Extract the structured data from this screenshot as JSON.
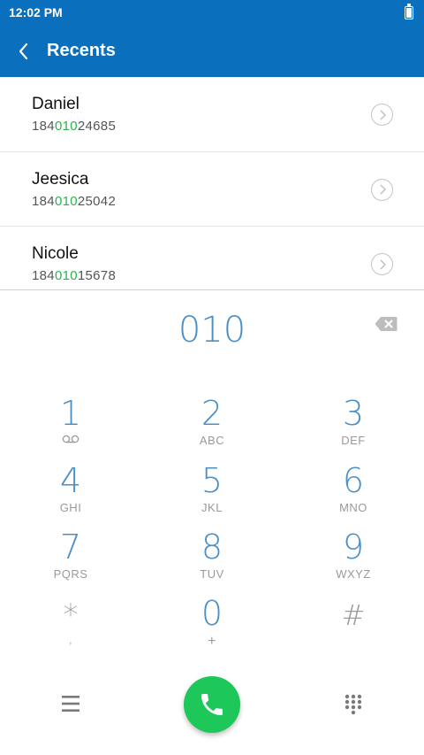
{
  "status_bar": {
    "time": "12:02 PM",
    "battery_icon": "battery-charging-icon"
  },
  "app_bar": {
    "title": "Recents",
    "back_icon": "chevron-left-icon"
  },
  "recents": [
    {
      "name": "Daniel",
      "number_prefix": "184",
      "number_match": "010",
      "number_suffix": "24685"
    },
    {
      "name": "Jeesica",
      "number_prefix": "184",
      "number_match": "010",
      "number_suffix": "25042"
    },
    {
      "name": "Nicole",
      "number_prefix": "184",
      "number_match": "010",
      "number_suffix": "15678"
    }
  ],
  "dialer": {
    "input_value": "010",
    "keys": [
      {
        "digit": "1",
        "letters": "",
        "sub_icon": "voicemail-icon"
      },
      {
        "digit": "2",
        "letters": "ABC"
      },
      {
        "digit": "3",
        "letters": "DEF"
      },
      {
        "digit": "4",
        "letters": "GHI"
      },
      {
        "digit": "5",
        "letters": "JKL"
      },
      {
        "digit": "6",
        "letters": "MNO"
      },
      {
        "digit": "7",
        "letters": "PQRS"
      },
      {
        "digit": "8",
        "letters": "TUV"
      },
      {
        "digit": "9",
        "letters": "WXYZ"
      },
      {
        "digit": "*",
        "letters": ","
      },
      {
        "digit": "0",
        "letters": "+"
      },
      {
        "digit": "#",
        "letters": ""
      }
    ]
  },
  "colors": {
    "primary": "#0a6fbd",
    "accent_digit": "#4a8fc7",
    "match": "#2bb34a",
    "call": "#1ec75a"
  }
}
